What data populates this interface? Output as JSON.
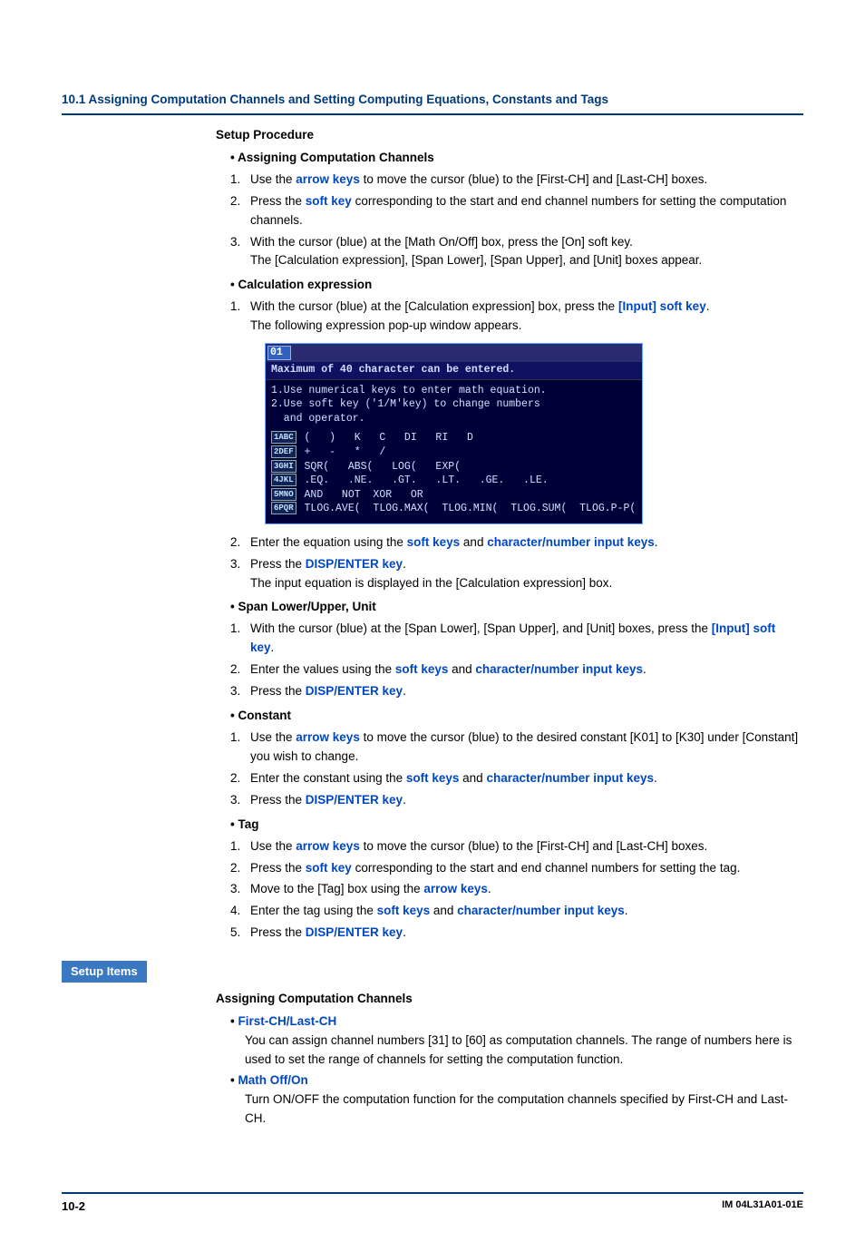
{
  "header": "10.1  Assigning Computation Channels and Setting Computing Equations, Constants and Tags",
  "setup_procedure_title": "Setup Procedure",
  "assign": {
    "title": "Assigning Computation Channels",
    "li1_a": "Use the ",
    "li1_arrow": "arrow keys",
    "li1_b": " to move the cursor (blue) to the [First-CH] and [Last-CH] boxes.",
    "li2_a": "Press the ",
    "li2_soft": "soft key",
    "li2_b": " corresponding to the start and end channel numbers for setting the computation channels.",
    "li3_a": "With the cursor (blue) at the [Math On/Off] box, press the [On] soft key.",
    "li3_b": "The [Calculation expression], [Span Lower], [Span Upper], and [Unit] boxes appear."
  },
  "calc": {
    "title": "Calculation expression",
    "li1_a": "With the cursor (blue) at the [Calculation expression] box, press the ",
    "li1_link": "[Input] soft key",
    "li1_b": ".",
    "li1_c": "The following expression pop-up window appears.",
    "popup": {
      "badge": "01",
      "max": "Maximum of 40 character can be entered.",
      "inst1": "1.Use numerical keys to enter math equation.",
      "inst2": "2.Use soft key ('1/M'key) to change numbers",
      "inst3": "  and operator.",
      "r1": " (   )   K   C   DI   RI   D",
      "r2": " +   -   *   /",
      "r3": " SQR(   ABS(   LOG(   EXP(",
      "r4": " .EQ.   .NE.   .GT.   .LT.   .GE.   .LE.",
      "r5": " AND   NOT  XOR   OR",
      "r6": " TLOG.AVE(  TLOG.MAX(  TLOG.MIN(  TLOG.SUM(  TLOG.P-P(",
      "k1": "1ABC",
      "k2": "2DEF",
      "k3": "3GHI",
      "k4": "4JKL",
      "k5": "5MNO",
      "k6": "6PQR"
    },
    "li2_a": "Enter the equation using the ",
    "li2_soft": "soft keys",
    "li2_and": " and ",
    "li2_char": "character/number input keys",
    "li2_b": ".",
    "li3_a": "Press the ",
    "li3_link": "DISP/ENTER key",
    "li3_b": ".",
    "li3_c": "The input equation is displayed in the [Calculation expression] box."
  },
  "span": {
    "title": "Span Lower/Upper, Unit",
    "li1_a": "With the cursor (blue) at the [Span Lower], [Span Upper], and [Unit] boxes, press the ",
    "li1_link": "[Input] soft key",
    "li1_b": ".",
    "li2_a": "Enter the values using the ",
    "li2_soft": "soft keys",
    "li2_and": " and ",
    "li2_char": "character/number input keys",
    "li2_b": ".",
    "li3_a": "Press the ",
    "li3_link": "DISP/ENTER key",
    "li3_b": "."
  },
  "constant": {
    "title": "Constant",
    "li1_a": "Use the ",
    "li1_arrow": "arrow keys",
    "li1_b": " to move the cursor (blue) to the desired constant [K01] to [K30] under [Constant] you wish to change.",
    "li2_a": "Enter the constant using the ",
    "li2_soft": "soft keys",
    "li2_and": " and ",
    "li2_char": "character/number input keys",
    "li2_b": ".",
    "li3_a": "Press the ",
    "li3_link": "DISP/ENTER key",
    "li3_b": "."
  },
  "tag": {
    "title": "Tag",
    "li1_a": "Use the ",
    "li1_arrow": "arrow keys",
    "li1_b": " to move the cursor (blue) to the [First-CH] and [Last-CH] boxes.",
    "li2_a": "Press the ",
    "li2_soft": "soft key",
    "li2_b": " corresponding to the start and end channel numbers for setting the tag.",
    "li3_a": "Move to the [Tag] box using the ",
    "li3_arrow": "arrow keys",
    "li3_b": ".",
    "li4_a": "Enter the tag using the ",
    "li4_soft": "soft keys",
    "li4_and": " and ",
    "li4_char": "character/number input keys",
    "li4_b": ".",
    "li5_a": "Press the ",
    "li5_link": "DISP/ENTER key",
    "li5_b": "."
  },
  "setup_items_label": "Setup Items",
  "setup": {
    "title": "Assigning Computation Channels",
    "first": {
      "label": "First-CH/Last-CH",
      "text": "You can assign channel numbers [31] to [60] as computation channels.  The range of numbers here is used to set the range of channels for setting the computation function."
    },
    "math": {
      "label": "Math Off/On",
      "text": "Turn ON/OFF the computation function for the computation channels specified by First-CH and Last-CH."
    }
  },
  "footer": {
    "page": "10-2",
    "doc": "IM 04L31A01-01E"
  }
}
